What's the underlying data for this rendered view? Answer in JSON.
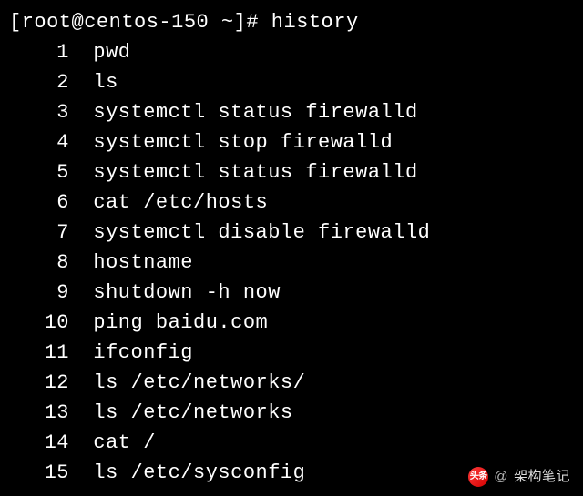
{
  "prompt": "[root@centos-150 ~]# ",
  "command": "history",
  "history": [
    {
      "n": "1",
      "cmd": "pwd"
    },
    {
      "n": "2",
      "cmd": "ls"
    },
    {
      "n": "3",
      "cmd": "systemctl status firewalld"
    },
    {
      "n": "4",
      "cmd": "systemctl stop firewalld"
    },
    {
      "n": "5",
      "cmd": "systemctl status firewalld"
    },
    {
      "n": "6",
      "cmd": "cat /etc/hosts"
    },
    {
      "n": "7",
      "cmd": "systemctl disable firewalld"
    },
    {
      "n": "8",
      "cmd": "hostname"
    },
    {
      "n": "9",
      "cmd": "shutdown -h now"
    },
    {
      "n": "10",
      "cmd": "ping baidu.com"
    },
    {
      "n": "11",
      "cmd": "ifconfig"
    },
    {
      "n": "12",
      "cmd": "ls /etc/networks/"
    },
    {
      "n": "13",
      "cmd": "ls /etc/networks"
    },
    {
      "n": "14",
      "cmd": "cat /"
    },
    {
      "n": "15",
      "cmd": "ls /etc/sysconfig"
    }
  ],
  "watermark": {
    "logo_text": "头条",
    "at": "@",
    "name": "架构笔记"
  }
}
